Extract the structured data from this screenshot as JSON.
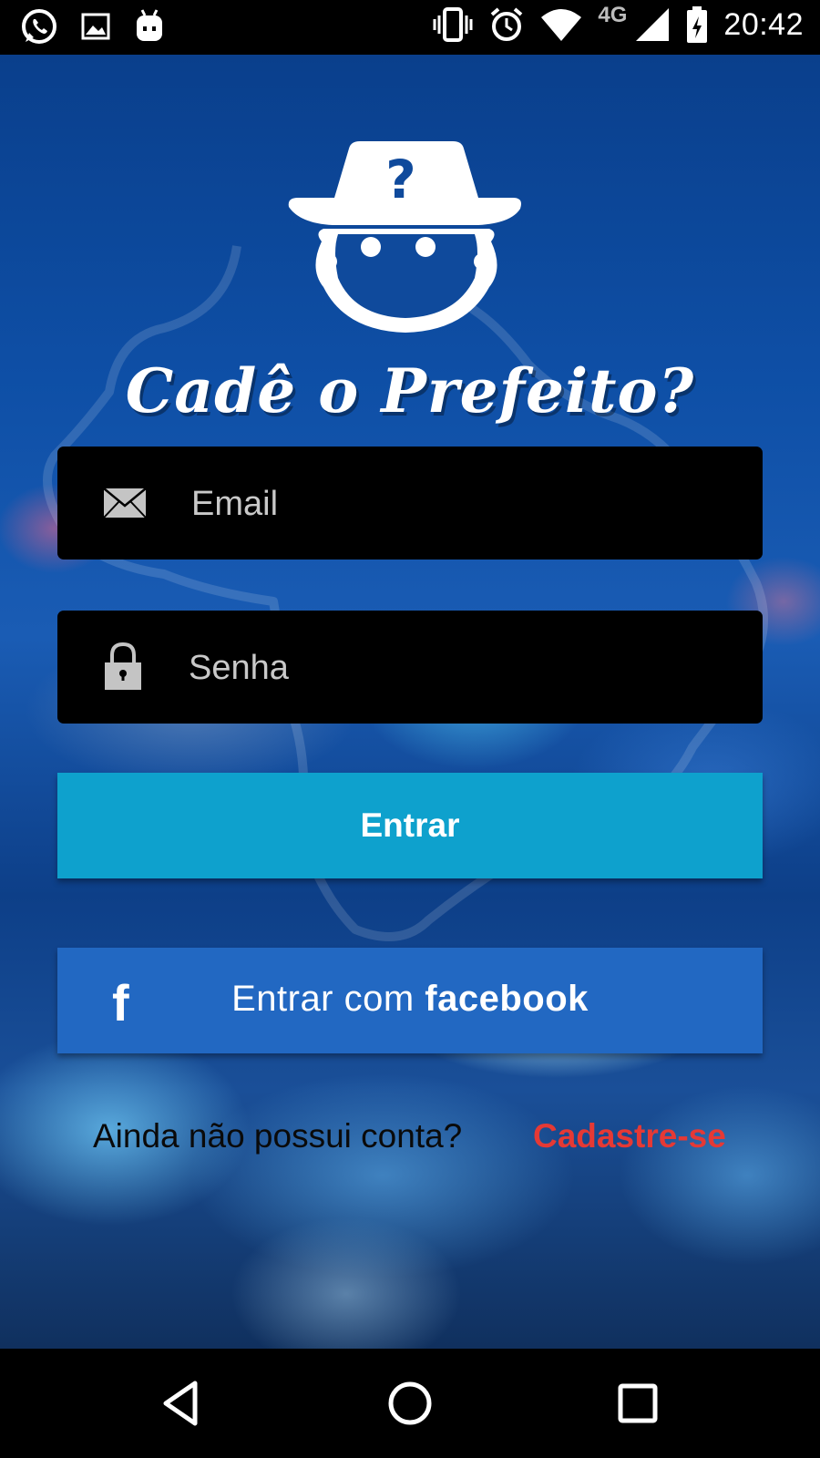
{
  "status_bar": {
    "time": "20:42",
    "network": "4G",
    "left_icons": [
      "whatsapp-icon",
      "image-icon",
      "android-icon"
    ],
    "right_icons": [
      "vibrate-icon",
      "alarm-icon",
      "wifi-icon",
      "signal-icon",
      "battery-icon"
    ]
  },
  "app": {
    "brand_title": "Cadê o Prefeito?",
    "logo_icon": "detective-logo"
  },
  "form": {
    "email_placeholder": "Email",
    "password_placeholder": "Senha",
    "login_label": "Entrar",
    "facebook_prefix": "Entrar com ",
    "facebook_brand": "facebook",
    "facebook_icon_glyph": "f",
    "signup_question": "Ainda não possui conta?",
    "signup_link": "Cadastre-se"
  },
  "colors": {
    "login_button": "#0ea1cd",
    "facebook_button": "#2268c2",
    "signup_link": "#e53935",
    "input_background": "#000000"
  },
  "nav_bar": {
    "buttons": [
      "back-icon",
      "home-icon",
      "recents-icon"
    ]
  }
}
